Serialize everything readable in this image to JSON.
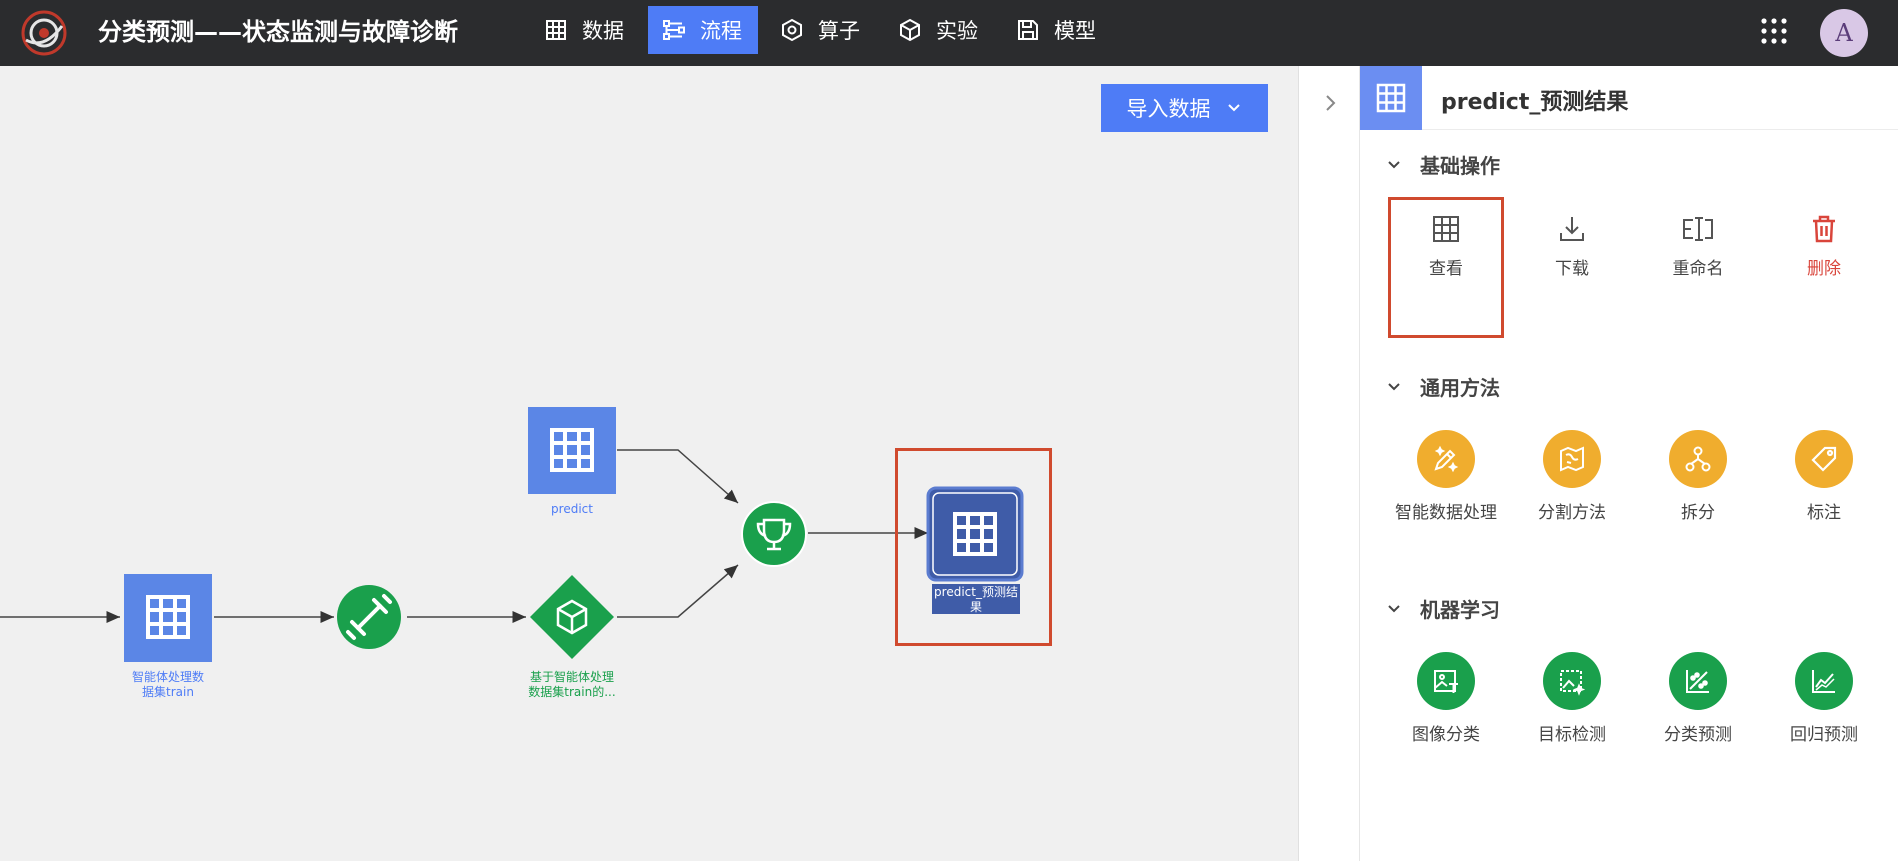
{
  "app": {
    "title": "分类预测——状态监测与故障诊断",
    "avatar_letter": "A"
  },
  "nav": [
    {
      "label": "数据",
      "icon": "table-icon",
      "active": false
    },
    {
      "label": "流程",
      "icon": "flow-icon",
      "active": true
    },
    {
      "label": "算子",
      "icon": "hexagon-icon",
      "active": false
    },
    {
      "label": "实验",
      "icon": "cube-icon",
      "active": false
    },
    {
      "label": "模型",
      "icon": "save-icon",
      "active": false
    }
  ],
  "canvas": {
    "import_button": "导入数据",
    "nodes": {
      "train_dataset": "智能体处理数据集train",
      "train_dataset_line1": "智能体处理数",
      "train_dataset_line2": "据集train",
      "predict": "predict",
      "model_line1": "基于智能体处理",
      "model_line2": "数据集train的...",
      "result_line1": "predict_预测结",
      "result_line2": "果"
    }
  },
  "panel": {
    "title": "predict_预测结果",
    "sections": [
      {
        "title": "基础操作",
        "tools": [
          {
            "label": "查看",
            "icon": "table-icon"
          },
          {
            "label": "下载",
            "icon": "download-icon"
          },
          {
            "label": "重命名",
            "icon": "rename-icon"
          },
          {
            "label": "删除",
            "icon": "trash-icon"
          }
        ]
      },
      {
        "title": "通用方法",
        "tools": [
          {
            "label": "智能数据处理",
            "icon": "magic-pen-icon"
          },
          {
            "label": "分割方法",
            "icon": "map-split-icon"
          },
          {
            "label": "拆分",
            "icon": "tree-split-icon"
          },
          {
            "label": "标注",
            "icon": "tag-icon"
          }
        ]
      },
      {
        "title": "机器学习",
        "tools": [
          {
            "label": "图像分类",
            "icon": "image-classify-icon"
          },
          {
            "label": "目标检测",
            "icon": "object-detect-icon"
          },
          {
            "label": "分类预测",
            "icon": "scatter-classify-icon"
          },
          {
            "label": "回归预测",
            "icon": "line-regression-icon"
          }
        ]
      }
    ]
  },
  "colors": {
    "topbar": "#2b2c2e",
    "accent_blue": "#4e7cf6",
    "node_blue": "#5b86e6",
    "node_dark_blue": "#3f5ca8",
    "node_green": "#1aa04c",
    "highlight_red": "#d04a2e",
    "orange": "#f0ad2e"
  }
}
